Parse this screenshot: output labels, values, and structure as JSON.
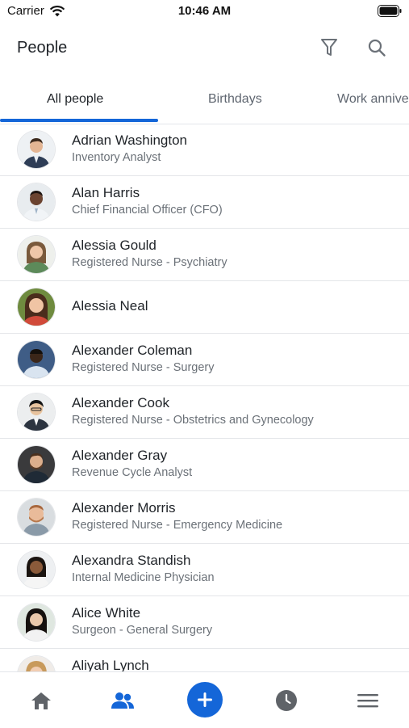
{
  "status": {
    "carrier": "Carrier",
    "time": "10:46 AM"
  },
  "header": {
    "title": "People"
  },
  "tabs": [
    "All people",
    "Birthdays",
    "Work anniversaries"
  ],
  "people": [
    {
      "name": "Adrian Washington",
      "role": "Inventory Analyst"
    },
    {
      "name": "Alan Harris",
      "role": "Chief Financial Officer (CFO)"
    },
    {
      "name": "Alessia Gould",
      "role": "Registered Nurse - Psychiatry"
    },
    {
      "name": "Alessia Neal",
      "role": ""
    },
    {
      "name": "Alexander Coleman",
      "role": "Registered Nurse - Surgery"
    },
    {
      "name": "Alexander Cook",
      "role": "Registered Nurse - Obstetrics and Gynecology"
    },
    {
      "name": "Alexander Gray",
      "role": "Revenue Cycle Analyst"
    },
    {
      "name": "Alexander Morris",
      "role": "Registered Nurse - Emergency Medicine"
    },
    {
      "name": "Alexandra Standish",
      "role": "Internal Medicine Physician"
    },
    {
      "name": "Alice White",
      "role": "Surgeon - General Surgery"
    },
    {
      "name": "Aliyah Lynch",
      "role": ""
    }
  ],
  "colors": {
    "accent": "#1466d8",
    "nav_inactive": "#5f6368",
    "divider": "#e4e6e9"
  },
  "nav": [
    "home-icon",
    "people-icon",
    "add-icon",
    "clock-icon",
    "menu-icon"
  ]
}
